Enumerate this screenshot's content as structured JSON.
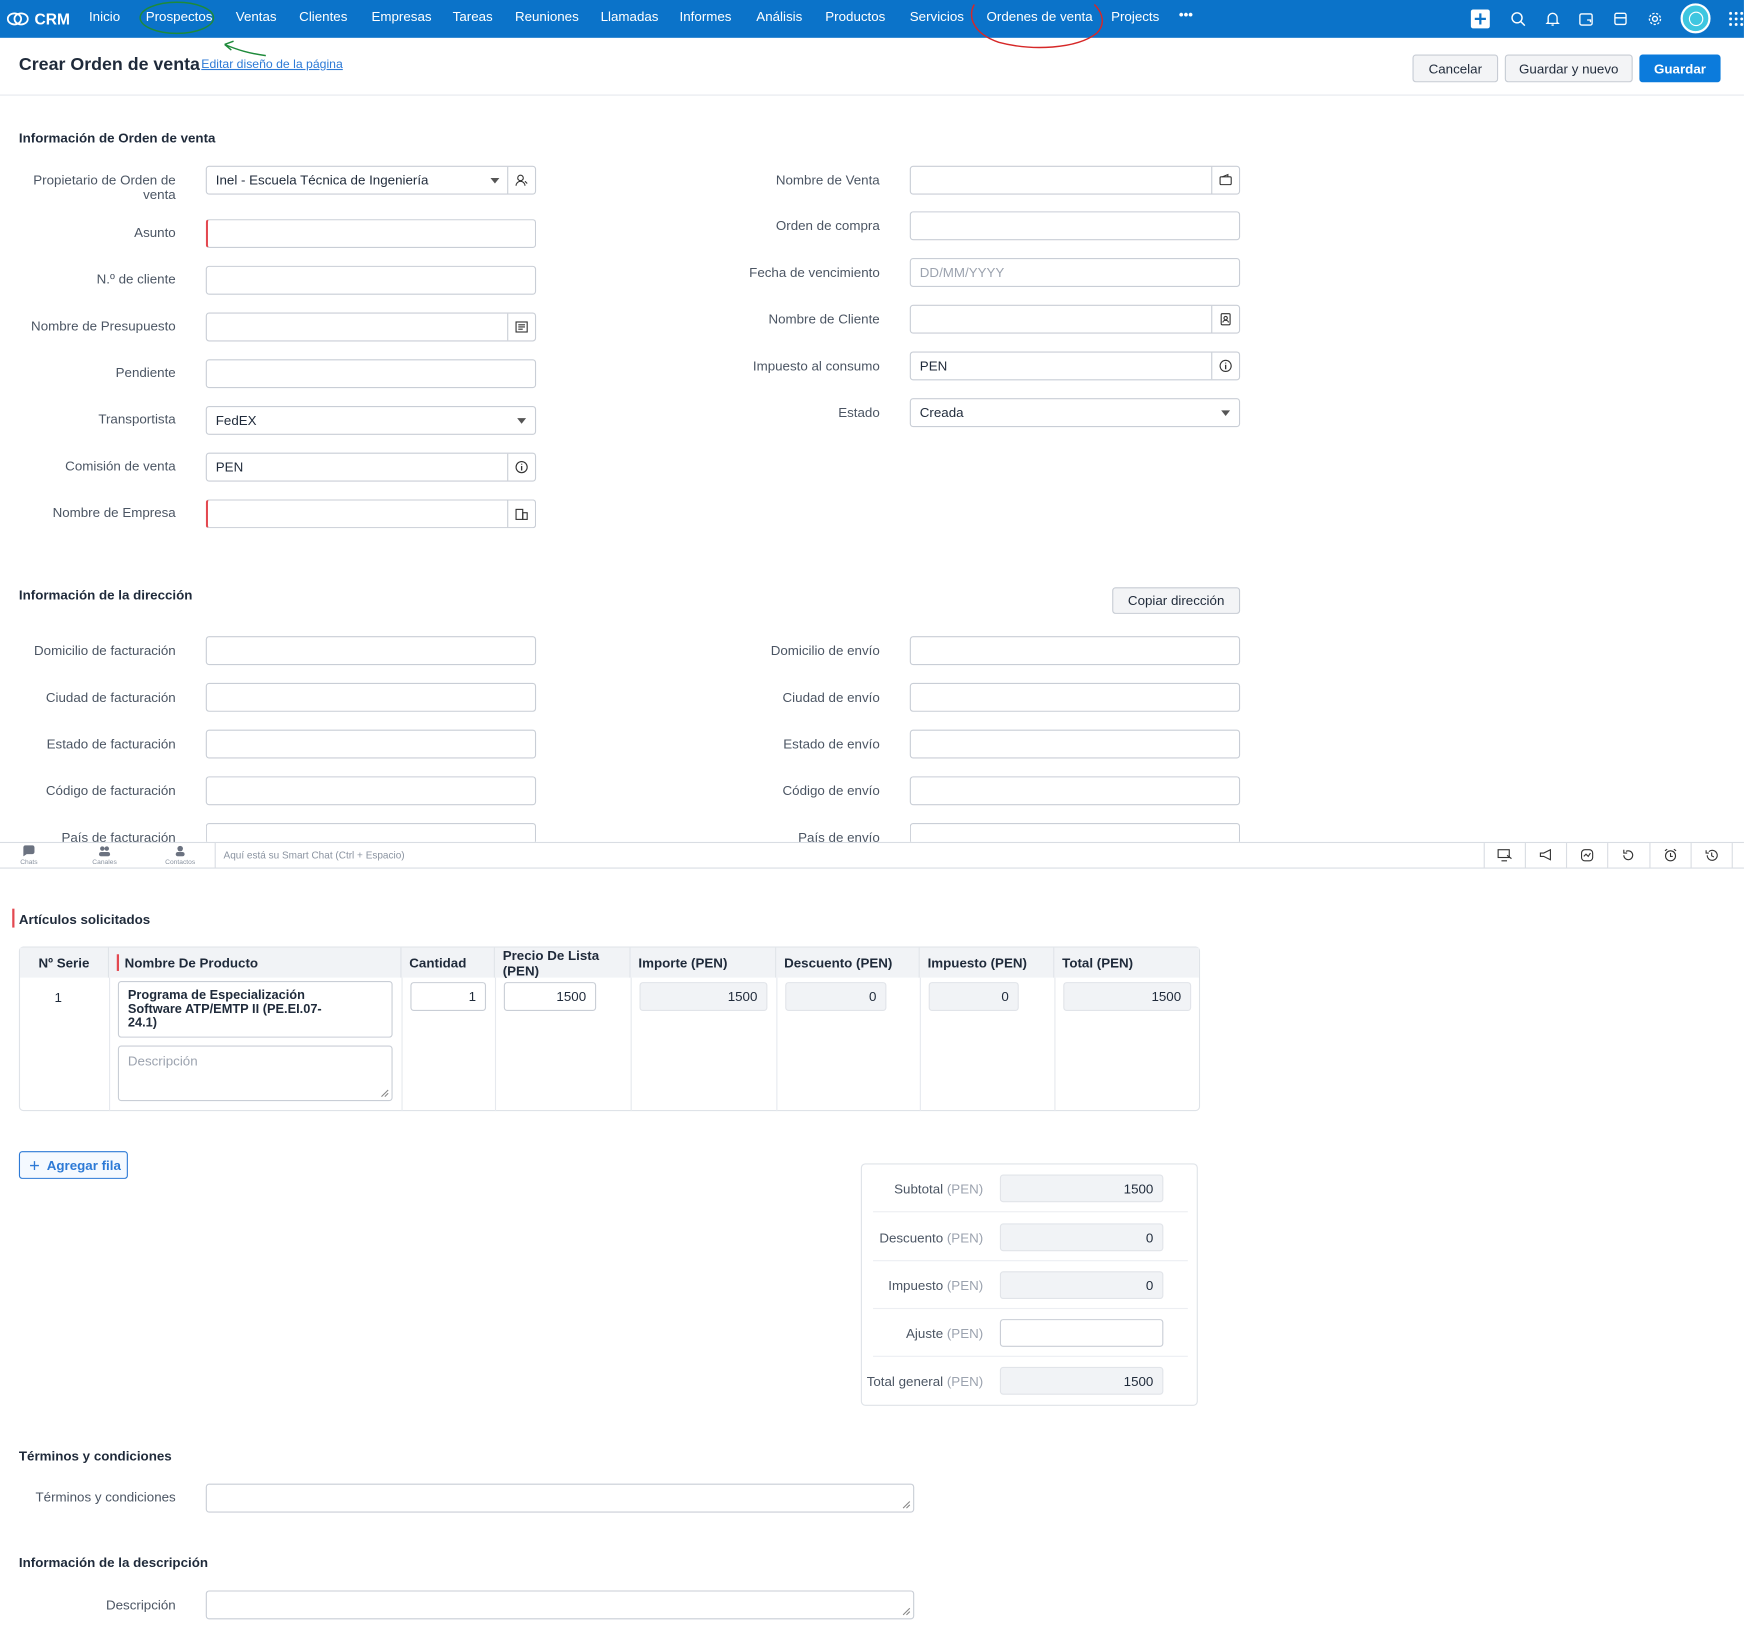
{
  "nav": {
    "logo": "CRM",
    "items": [
      "Inicio",
      "Prospectos",
      "Ventas",
      "Clientes",
      "Empresas",
      "Tareas",
      "Reuniones",
      "Llamadas",
      "Informes",
      "Análisis",
      "Productos",
      "Servicios",
      "Ordenes de venta",
      "Projects",
      "•••"
    ],
    "active": "Ordenes de venta",
    "right_icons": [
      "plus-icon",
      "search-icon",
      "bell-icon",
      "calendar-icon",
      "store-icon",
      "gear-icon",
      "avatar",
      "apps-grid-icon"
    ],
    "color": "#0b73c9"
  },
  "header": {
    "title": "Crear Orden de venta",
    "edit_link": "Editar diseño de la página",
    "cancel": "Cancelar",
    "save_new": "Guardar y nuevo",
    "save": "Guardar"
  },
  "order_info": {
    "title": "Información de Orden de venta",
    "owner_label_1": "Propietario de Orden de",
    "owner_label_2": "venta",
    "owner_value": "Inel - Escuela Técnica de Ingeniería",
    "subject_label": "Asunto",
    "customer_no_label": "N.º de cliente",
    "quote_label": "Nombre de Presupuesto",
    "pending_label": "Pendiente",
    "carrier_label": "Transportista",
    "carrier_value": "FedEX",
    "commission_label": "Comisión de venta",
    "commission_value": "PEN",
    "company_label": "Nombre de Empresa",
    "deal_label": "Nombre de Venta",
    "po_label": "Orden de compra",
    "due_label": "Fecha de vencimiento",
    "due_placeholder": "DD/MM/YYYY",
    "contact_label": "Nombre de Cliente",
    "excise_label": "Impuesto al consumo",
    "excise_value": "PEN",
    "status_label": "Estado",
    "status_value": "Creada"
  },
  "address": {
    "title": "Información de la dirección",
    "copy_button": "Copiar dirección",
    "billing_street": "Domicilio de facturación",
    "billing_city": "Ciudad de facturación",
    "billing_state": "Estado de facturación",
    "billing_code": "Código de facturación",
    "billing_country": "País de facturación",
    "shipping_street": "Domicilio de envío",
    "shipping_city": "Ciudad de envío",
    "shipping_state": "Estado de envío",
    "shipping_code": "Código de envío",
    "shipping_country": "País de envío"
  },
  "chat": {
    "chats": "Chats",
    "channels": "Canales",
    "contacts": "Contactos",
    "placeholder": "Aquí está su Smart Chat (Ctrl + Espacio)"
  },
  "items": {
    "title": "Artículos solicitados",
    "headers": [
      "Nº Serie",
      "Nombre De Producto",
      "Cantidad",
      "Precio De Lista (PEN)",
      "Importe (PEN)",
      "Descuento (PEN)",
      "Impuesto (PEN)",
      "Total (PEN)"
    ],
    "row": {
      "serial": "1",
      "product_l1": "Programa de Especialización",
      "product_l2": "Software ATP/EMTP II (PE.EI.07-",
      "product_l3": "24.1)",
      "description_placeholder": "Descripción",
      "quantity": "1",
      "list_price": "1500",
      "amount": "1500",
      "discount": "0",
      "tax": "0",
      "total": "1500"
    },
    "add_row": "Agregar fila"
  },
  "totals": {
    "currency": "(PEN)",
    "subtotal_label": "Subtotal",
    "subtotal": "1500",
    "discount_label": "Descuento",
    "discount": "0",
    "tax_label": "Impuesto",
    "tax": "0",
    "adjustment_label": "Ajuste",
    "grand_label": "Total general",
    "grand": "1500"
  },
  "terms": {
    "title": "Términos y condiciones",
    "label": "Términos y condiciones"
  },
  "description": {
    "title": "Información de la descripción",
    "label": "Descripción"
  }
}
